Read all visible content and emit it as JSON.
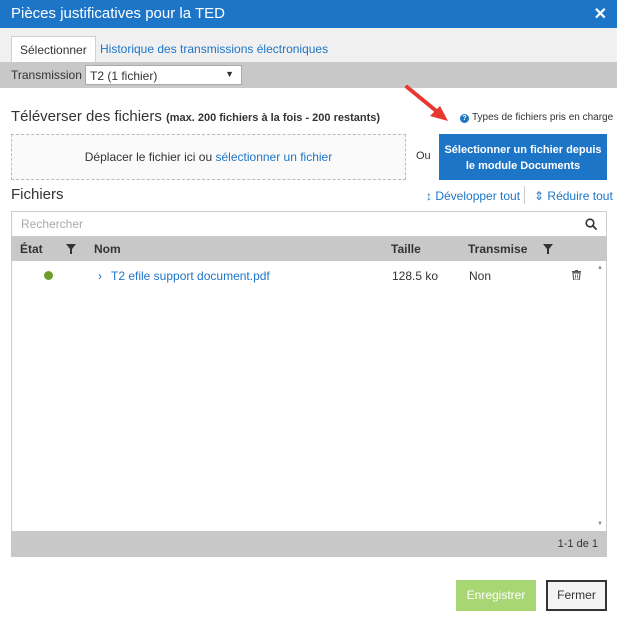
{
  "dialog": {
    "title": "Pièces justificatives pour la TED",
    "close_glyph": "✕"
  },
  "tabs": [
    {
      "label": "Sélectionner",
      "active": true
    },
    {
      "label": "Historique des transmissions électroniques",
      "active": false
    }
  ],
  "transmission": {
    "label": "Transmission",
    "selected": "T2 (1 fichier)"
  },
  "upload": {
    "title": "Téléverser des fichiers",
    "subtitle": "(max. 200 fichiers à la fois - 200 restants)",
    "file_types_link": "Types de fichiers pris en charge",
    "dropzone_text": "Déplacer le fichier ici ou ",
    "dropzone_link": "sélectionner un fichier",
    "or_text": "Ou",
    "documents_button_line1": "Sélectionner un fichier depuis",
    "documents_button_line2": "le module Documents"
  },
  "files": {
    "title": "Fichiers",
    "expand_all": "Développer tout",
    "collapse_all": "Réduire tout",
    "search_placeholder": "Rechercher",
    "columns": {
      "state": "État",
      "name": "Nom",
      "size": "Taille",
      "transmitted": "Transmise"
    },
    "rows": [
      {
        "state": "ok",
        "name": "T2 efile support document.pdf",
        "size": "128.5 ko",
        "transmitted": "Non"
      }
    ],
    "pagination": "1-1 de 1"
  },
  "footer": {
    "save_label": "Enregistrer",
    "close_label": "Fermer"
  },
  "colors": {
    "brand": "#1d75c8",
    "save": "#a8d672",
    "ok": "#6a9e2b",
    "arrow": "#e8372f"
  }
}
